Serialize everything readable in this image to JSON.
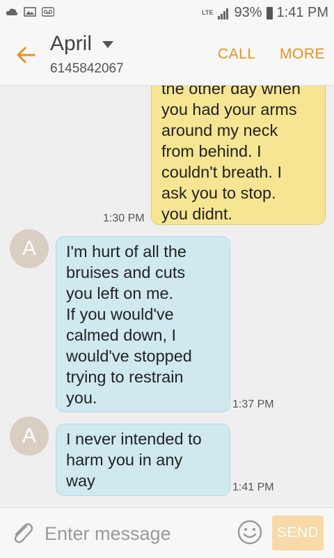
{
  "status_bar": {
    "network": "LTE",
    "battery": "93%",
    "time": "1:41 PM",
    "icons": [
      "cloud-icon",
      "image-icon",
      "voicemail-icon",
      "signal-icon",
      "battery-icon"
    ]
  },
  "header": {
    "contact_name": "April",
    "contact_number": "6145842067",
    "call_label": "CALL",
    "more_label": "MORE",
    "accent_color": "#e8911f"
  },
  "messages": [
    {
      "direction": "outgoing",
      "text": "the other day when\nyou had your arms\naround my neck\nfrom behind. I\ncouldn't breath. I\nask you to stop.\nyou didnt.",
      "time": "1:30 PM"
    },
    {
      "direction": "incoming",
      "avatar": "A",
      "text": "I'm hurt of all the\nbruises and cuts\nyou left on me.\nIf you would've\ncalmed down, I\nwould've stopped\ntrying to restrain\nyou.",
      "time": "1:37 PM"
    },
    {
      "direction": "incoming",
      "avatar": "A",
      "text": "I never intended to\nharm you in any\nway",
      "time": "1:41 PM"
    }
  ],
  "composer": {
    "placeholder": "Enter message",
    "send_label": "SEND"
  },
  "colors": {
    "outgoing_bubble": "#f6e592",
    "incoming_bubble": "#cfe9ee",
    "send_button": "#f9d9a8"
  }
}
